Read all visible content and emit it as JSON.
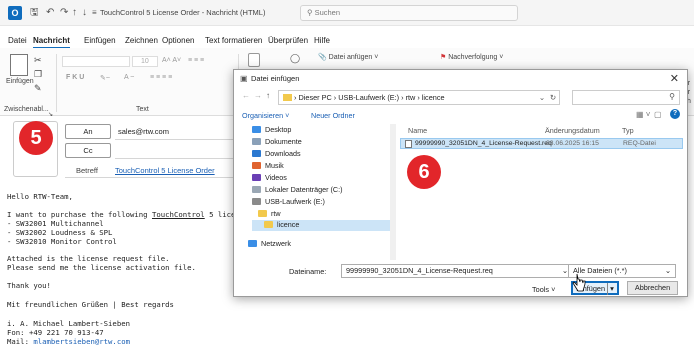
{
  "window": {
    "title": "TouchControl 5 License Order  -  Nachricht (HTML)",
    "search_placeholder": "Suchen"
  },
  "menu": [
    "Datei",
    "Nachricht",
    "Einfügen",
    "Zeichnen",
    "Optionen",
    "Text formatieren",
    "Überprüfen",
    "Hilfe"
  ],
  "ribbon": {
    "paste_label": "Einfügen",
    "clipboard_group": "Zwischenabl...",
    "text_group": "Text",
    "attach_label": "Datei anfügen",
    "followup_label": "Nachverfolgung",
    "font_size": "10",
    "right_cut_1": "her",
    "right_cut_2": "der",
    "right_cut_3": "sch"
  },
  "mail": {
    "to_label": "An",
    "to_value": "sales@rtw.com",
    "cc_label": "Cc",
    "subject_label": "Betreff",
    "subject_value": "TouchControl 5 License Order",
    "step_badge": "5",
    "body": {
      "greeting": "Hello RTW-Team,",
      "line1_a": "I want to purchase the following ",
      "line1_link": "TouchControl",
      "line1_b": " 5 licenses:",
      "item1": "- SW32001 Multichannel",
      "item2": "- SW32002 Loudness & SPL",
      "item3": "- SW32010 Monitor Control",
      "attach1": "Attached is the license request file.",
      "attach2": "Please send me the license activation file.",
      "thanks": "Thank you!",
      "regards": "Mit freundlichen Grüßen | Best regards",
      "sig_name": "i. A. Michael Lambert-Sieben",
      "sig_phone": "Fon: +49 221 70 913-47",
      "sig_mail_label": "Mail: ",
      "sig_mail": "mlambertsieben@rtw.com"
    }
  },
  "dialog": {
    "title": "Datei einfügen",
    "breadcrumb": [
      "Dieser PC",
      "USB-Laufwerk (E:)",
      "rtw",
      "licence"
    ],
    "organize": "Organisieren",
    "new_folder": "Neuer Ordner",
    "nav": [
      {
        "label": "Desktop",
        "color": "#3a8ee6"
      },
      {
        "label": "Dokumente",
        "color": "#8aa0b8"
      },
      {
        "label": "Downloads",
        "color": "#2b78d0"
      },
      {
        "label": "Musik",
        "color": "#e0632f"
      },
      {
        "label": "Videos",
        "color": "#6a3fb5"
      },
      {
        "label": "Lokaler Datenträger (C:)",
        "color": "#9aa7b4"
      },
      {
        "label": "USB-Laufwerk (E:)",
        "color": "#8a8a8a"
      },
      {
        "label": "rtw",
        "color": "#f2c94c"
      },
      {
        "label": "licence",
        "color": "#f2c94c"
      },
      {
        "label": "Netzwerk",
        "color": "#3a8ee6"
      }
    ],
    "col_name": "Name",
    "col_date": "Änderungsdatum",
    "col_type": "Typ",
    "file": {
      "name": "99999990_32051DN_4_License-Request.req",
      "date": "03.06.2025 16:15",
      "type": "REQ-Datei"
    },
    "step_badge": "6",
    "filename_label": "Dateiname:",
    "filename_value": "99999990_32051DN_4_License-Request.req",
    "filter": "Alle Dateien (*.*)",
    "tools": "Tools",
    "insert": "Einfügen",
    "cancel": "Abbrechen"
  }
}
